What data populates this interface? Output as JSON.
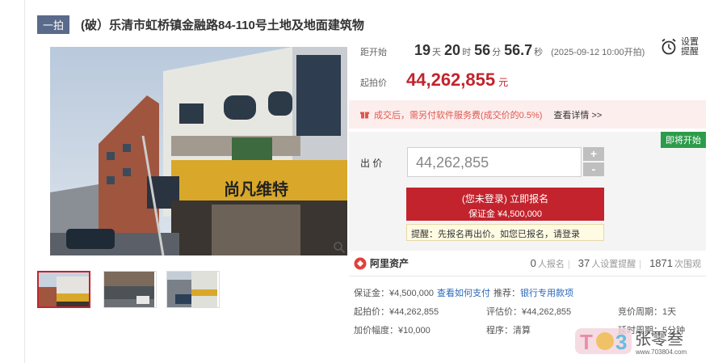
{
  "title": {
    "tag": "一拍",
    "text": "(破）乐清市虹桥镇金融路84-110号土地及地面建筑物"
  },
  "countdown": {
    "label": "距开始",
    "days": "19",
    "days_unit": "天",
    "hours": "20",
    "hours_unit": "时",
    "minutes": "56",
    "minutes_unit": "分",
    "seconds": "56.7",
    "seconds_unit": "秒",
    "start_text": "(2025-09-12 10:00开拍)"
  },
  "remind": {
    "label": "设置提醒",
    "icon": "alarm-clock-icon"
  },
  "start_price": {
    "label": "起拍价",
    "value": "44,262,855",
    "unit": "元"
  },
  "notice": {
    "icon": "gift-icon",
    "text": "成交后，需另付软件服务费(成交价的0.5%)",
    "link": "查看详情 >>"
  },
  "bid": {
    "badge": "即将开始",
    "label": "出 价",
    "value": "44,262,855",
    "plus": "+",
    "minus": "-",
    "signup_line1": "(您未登录) 立即报名",
    "signup_line2": "保证金 ¥4,500,000",
    "hint": "提醒：先报名再出价。如您已报名，请登录"
  },
  "ali": {
    "brand": "阿里资产",
    "signups": "0",
    "signups_label": "人报名",
    "reminders": "37",
    "reminders_label": "人设置提醒",
    "views": "1871",
    "views_label": "次围观"
  },
  "info": {
    "deposit": "保证金：¥4,500,000",
    "how_to_pay": "查看如何支付",
    "recommend_label": "推荐：",
    "recommend_link": "银行专用款项",
    "start_price": "起拍价：¥44,262,855",
    "eval_price": "评估价：¥44,262,855",
    "cycle": "竞价周期：1天",
    "increment": "加价幅度：¥10,000",
    "procedure": "程序：清算",
    "delay": "延时周期：5分钟"
  },
  "photo_sign": "尚凡维特",
  "colors": {
    "accent": "#c3232d",
    "green": "#2c9c4a",
    "link": "#2a67b7"
  },
  "watermark": {
    "brand": "张零叁",
    "url": "www.703804.com"
  }
}
